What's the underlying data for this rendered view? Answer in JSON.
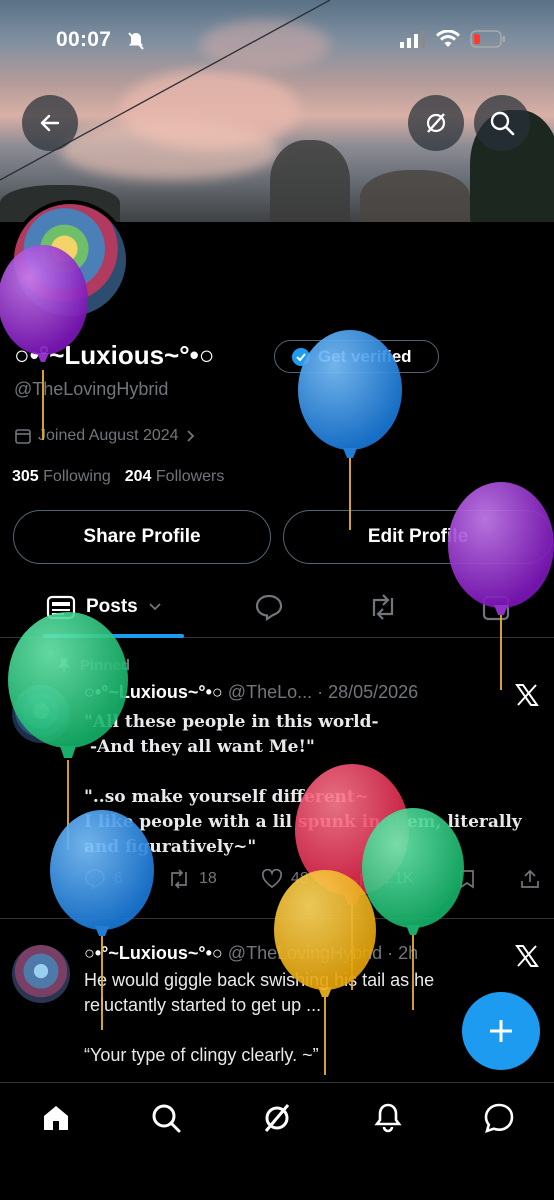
{
  "status_bar": {
    "time": "00:07"
  },
  "profile": {
    "display_name": "○•°~Luxious~°•○",
    "handle": "@TheLovingHybrid",
    "get_verified_label": "Get verified",
    "joined": "Joined August 2024",
    "following_count": "305",
    "following_label": "Following",
    "followers_count": "204",
    "followers_label": "Followers",
    "share_profile_label": "Share Profile",
    "edit_profile_label": "Edit Profile"
  },
  "tabs": {
    "posts_label": "Posts"
  },
  "posts": [
    {
      "pinned_label": "Pinned",
      "author": "○•°~Luxious~°•○",
      "handle_date": "@TheLo... · 28/05/2026",
      "lines": [
        "\"All these people in this world-",
        "  -And they all want Me!\"",
        "",
        "\"..so make yourself different~",
        " I like people with a lil spunk in them, literally",
        "and figuratively~\""
      ],
      "replies": "6",
      "reposts": "18",
      "likes": "48",
      "views": "2.1K"
    },
    {
      "author": "○•°~Luxious~°•○",
      "handle_date": "@TheLovingHybrid · 2h",
      "lines": [
        "He would giggle back swishing his tail as he",
        "reluctantly started to get up ...",
        "",
        "“Your type of clingy clearly. ~”"
      ]
    }
  ],
  "icons": {
    "back": "back-arrow-icon",
    "grok": "grok-icon",
    "search": "search-icon",
    "x_logo": "x-logo-icon",
    "compose": "plus-icon"
  },
  "colors": {
    "accent": "#1d9bf0",
    "muted": "#71767b",
    "border": "#2f3336"
  }
}
